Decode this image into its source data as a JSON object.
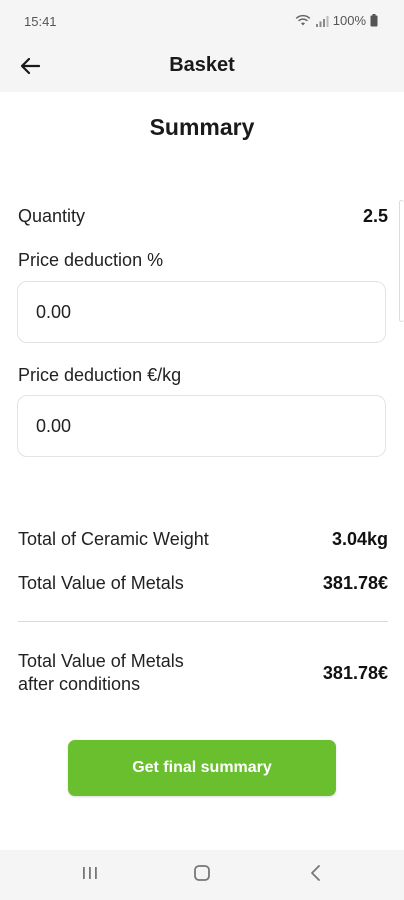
{
  "status_bar": {
    "time": "15:41",
    "battery": "100%"
  },
  "app_bar": {
    "title": "Basket"
  },
  "summary": {
    "title": "Summary",
    "quantity_label": "Quantity",
    "quantity_value": "2.5",
    "price_deduction_pct_label": "Price deduction %",
    "price_deduction_pct_value": "0.00",
    "price_deduction_kg_label": "Price deduction €/kg",
    "price_deduction_kg_value": "0.00",
    "ceramic_weight_label": "Total of Ceramic Weight",
    "ceramic_weight_value": "3.04kg",
    "metals_value_label": "Total Value of Metals",
    "metals_value_value": "381.78€",
    "after_conditions_label_line1": "Total Value of Metals",
    "after_conditions_label_line2": "after conditions",
    "after_conditions_value": "381.78€"
  },
  "cta": {
    "label": "Get final summary"
  },
  "colors": {
    "accent": "#6abf2e",
    "bar_background": "#f5f5f5"
  }
}
